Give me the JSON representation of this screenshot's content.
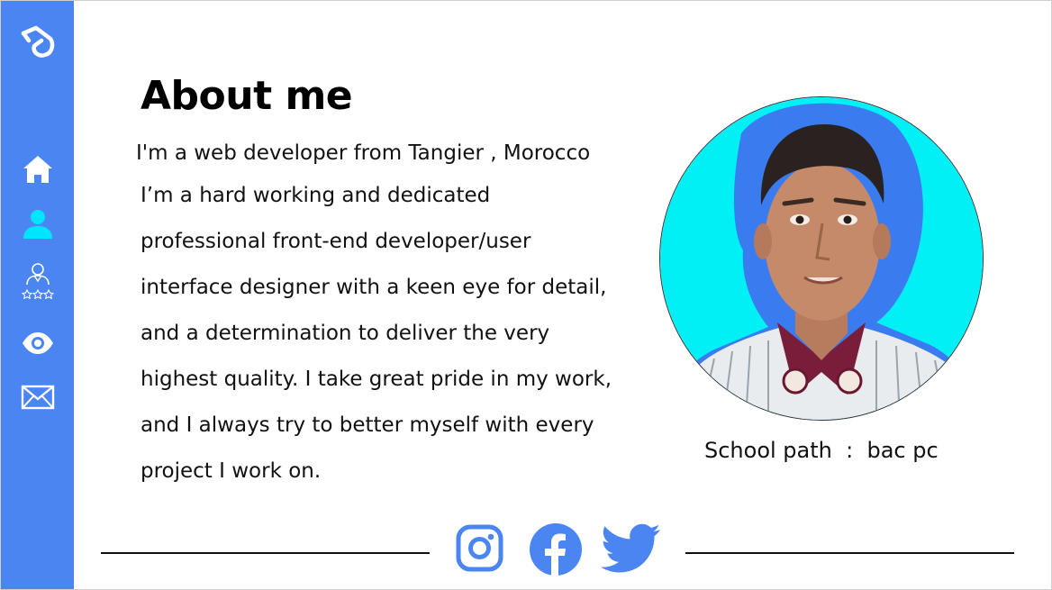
{
  "about": {
    "title": "About me",
    "intro": "I'm a web developer from Tangier , Morocco",
    "bio_lines": [
      "I’m a hard working and dedicated",
      "professional front-end developer/user",
      "interface designer with a keen eye for detail,",
      "and a determination to deliver the very",
      "highest quality. I take great pride in my work,",
      "and I always try to better myself with every",
      "project I work on."
    ],
    "school": "School path  :  bac pc"
  },
  "sidebar": {
    "items": [
      {
        "icon": "logo-icon"
      },
      {
        "icon": "home-icon"
      },
      {
        "icon": "user-icon"
      },
      {
        "icon": "skills-icon"
      },
      {
        "icon": "eye-icon"
      },
      {
        "icon": "mail-icon"
      }
    ]
  },
  "social": [
    "instagram-icon",
    "facebook-icon",
    "twitter-icon"
  ],
  "colors": {
    "sidebar": "#4a85f2",
    "active_icon": "#00e5ff",
    "accent": "#4a85f2"
  }
}
